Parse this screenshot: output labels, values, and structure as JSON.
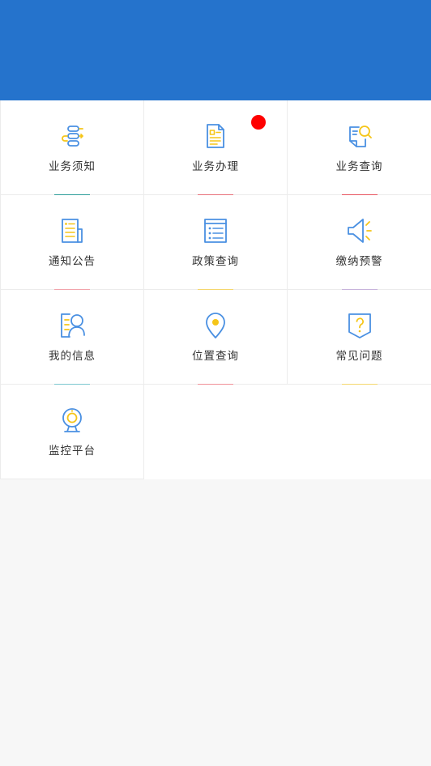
{
  "header": {
    "color": "#2573cc"
  },
  "menu": [
    {
      "label": "业务须知",
      "icon": "workflow-icon",
      "accent": "#2e9e9a"
    },
    {
      "label": "业务办理",
      "icon": "document-icon",
      "accent": "#e8707a",
      "badge": true
    },
    {
      "label": "业务查询",
      "icon": "search-document-icon",
      "accent": "#e85560"
    },
    {
      "label": "通知公告",
      "icon": "newspaper-icon",
      "accent": "#f2a4ac"
    },
    {
      "label": "政策查询",
      "icon": "list-document-icon",
      "accent": "#f5d76e"
    },
    {
      "label": "缴纳预警",
      "icon": "speaker-icon",
      "accent": "#c8b4dc"
    },
    {
      "label": "我的信息",
      "icon": "user-profile-icon",
      "accent": "#7cc7cf"
    },
    {
      "label": "位置查询",
      "icon": "location-pin-icon",
      "accent": "#f09098"
    },
    {
      "label": "常见问题",
      "icon": "help-question-icon",
      "accent": "#f5d76e"
    },
    {
      "label": "监控平台",
      "icon": "camera-icon",
      "accent": ""
    }
  ],
  "colors": {
    "icon_blue": "#4a90e2",
    "icon_yellow": "#f5c518",
    "badge_red": "#fe0000"
  }
}
